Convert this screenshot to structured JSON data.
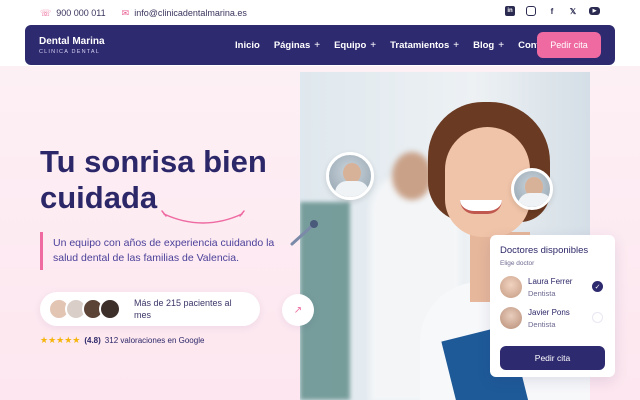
{
  "topbar": {
    "phone": "900 000 011",
    "email": "info@clinicadentalmarina.es",
    "socials": [
      "linkedin-icon",
      "instagram-icon",
      "facebook-icon",
      "x-icon",
      "youtube-icon"
    ]
  },
  "brand": {
    "name": "Dental Marina",
    "tagline": "CLINICA DENTAL"
  },
  "nav": {
    "items": [
      {
        "label": "Inicio",
        "dropdown": false
      },
      {
        "label": "Páginas",
        "dropdown": true
      },
      {
        "label": "Equipo",
        "dropdown": true
      },
      {
        "label": "Tratamientos",
        "dropdown": true
      },
      {
        "label": "Blog",
        "dropdown": true
      },
      {
        "label": "Contacto",
        "dropdown": false
      }
    ],
    "cta": "Pedir cita"
  },
  "hero": {
    "title_line1": "Tu sonrisa bien",
    "title_line2": "cuidada",
    "description": "Un equipo con años de experiencia cuidando la salud dental de las familias de Valencia.",
    "patients_text": "Más de 215 pacientes al mes",
    "rating_score": "(4.8)",
    "rating_text": "312 valoraciones en Google",
    "stars": 5
  },
  "doctors_card": {
    "title": "Doctores disponibles",
    "subtitle": "Elige doctor",
    "doctors": [
      {
        "name": "Laura Ferrer",
        "role": "Dentista",
        "selected": true
      },
      {
        "name": "Javier Pons",
        "role": "Dentista",
        "selected": false
      }
    ],
    "cta": "Pedir cita"
  },
  "colors": {
    "primary": "#2e2a70",
    "accent": "#ee6aa1",
    "star": "#f5b50c"
  }
}
